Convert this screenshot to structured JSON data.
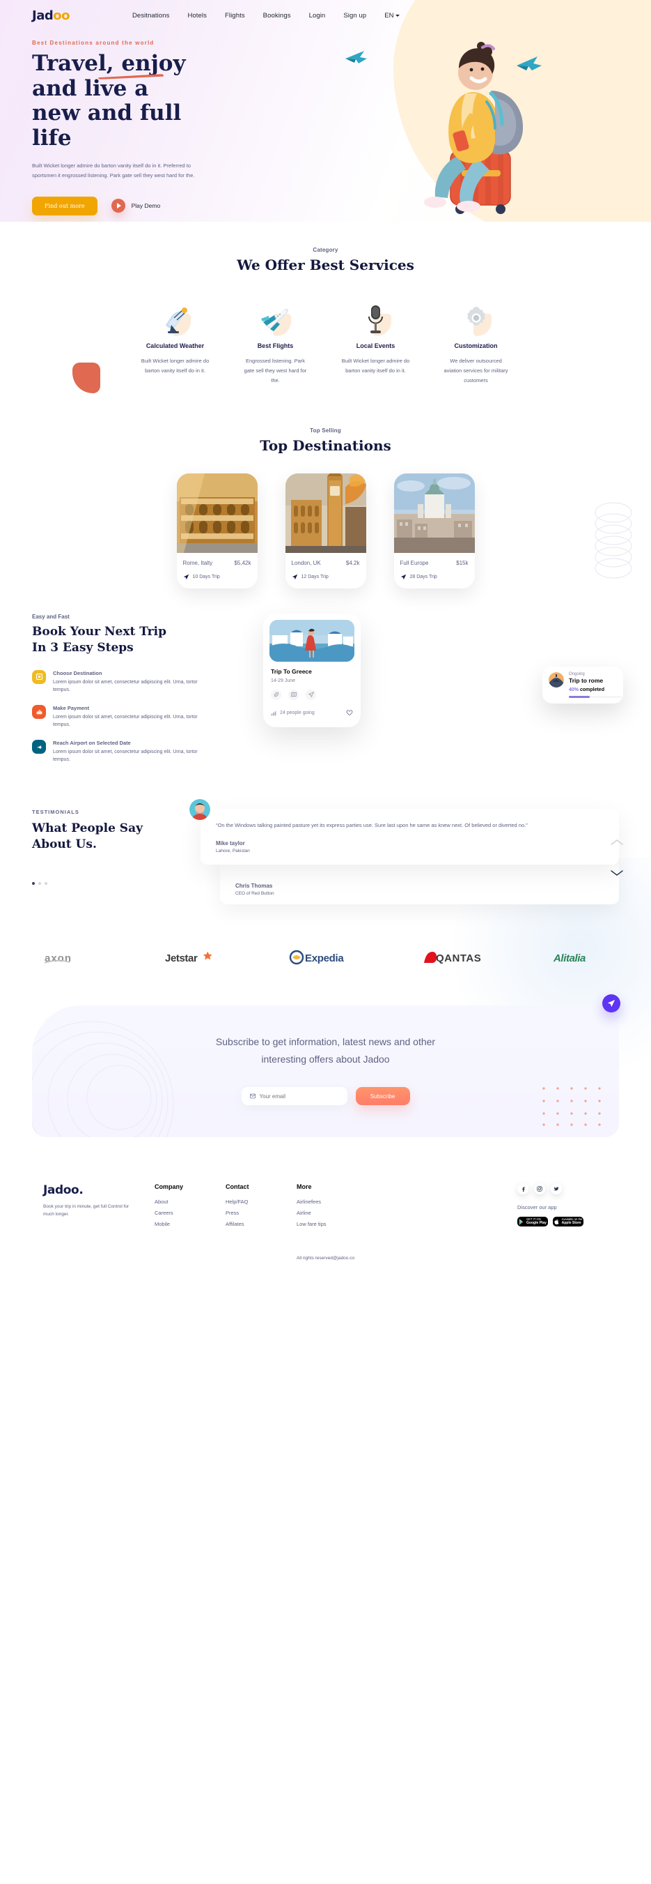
{
  "brand": {
    "name_prefix": "Jad",
    "name_suffix": "oo",
    "full": "Jadoo."
  },
  "nav": {
    "items": [
      {
        "label": "Desitnations"
      },
      {
        "label": "Hotels"
      },
      {
        "label": "Flights"
      },
      {
        "label": "Bookings"
      },
      {
        "label": "Login"
      },
      {
        "label": "Sign up"
      }
    ],
    "lang": "EN"
  },
  "hero": {
    "eyebrow": "Best Destinations around the world",
    "title_line1": "Travel, enjoy",
    "title_line2": "and live a",
    "title_line3": "new and full",
    "title_line4": "life",
    "paragraph": "Built Wicket longer admire do barton vanity itself do in it. Preferred to sportsmen it engrossed listening. Park gate sell they west hard for the.",
    "cta_primary": "Find out more",
    "cta_secondary": "Play Demo"
  },
  "services": {
    "eyebrow": "Category",
    "title": "We Offer Best Services",
    "cards": [
      {
        "icon": "satellite-dish-icon",
        "name": "Calculated Weather",
        "desc": "Built Wicket longer admire do barton vanity itself do in it."
      },
      {
        "icon": "airplane-icon",
        "name": "Best Flights",
        "desc": "Engrossed listening. Park gate sell they west hard for the."
      },
      {
        "icon": "microphone-icon",
        "name": "Local Events",
        "desc": "Built Wicket longer admire do barton vanity itself do in it."
      },
      {
        "icon": "gear-icon",
        "name": "Customization",
        "desc": "We deliver outsourced aviation services for military customers"
      }
    ]
  },
  "destinations": {
    "eyebrow": "Top Selling",
    "title": "Top Destinations",
    "cards": [
      {
        "city": "Rome, Italty",
        "price": "$5,42k",
        "days": "10 Days Trip",
        "image": "colosseum-photo"
      },
      {
        "city": "London, UK",
        "price": "$4.2k",
        "days": "12 Days Trip",
        "image": "big-ben-photo"
      },
      {
        "city": "Full Europe",
        "price": "$15k",
        "days": "28 Days Trip",
        "image": "helsinki-photo"
      }
    ]
  },
  "booking": {
    "eyebrow": "Easy and Fast",
    "title_line1": "Book Your Next Trip",
    "title_line2": "In 3 Easy Steps",
    "steps": [
      {
        "icon": "destination-icon",
        "color": "#F0BB1F",
        "name": "Choose Destination",
        "desc": "Lorem ipsum dolor sit amet, consectetur adipiscing elit. Urna, tortor tempus."
      },
      {
        "icon": "payment-icon",
        "color": "#F15A2B",
        "name": "Make Payment",
        "desc": "Lorem ipsum dolor sit amet, consectetur adipiscing elit. Urna, tortor tempus."
      },
      {
        "icon": "airport-icon",
        "color": "#006380",
        "name": "Reach Airport on Selected Date",
        "desc": "Lorem ipsum dolor sit amet, consectetur adipiscing elit. Urna, tortor tempus."
      }
    ],
    "trip_card": {
      "title": "Trip To Greece",
      "date": "14-29 June",
      "people": "24 people going",
      "image": "greece-santorini-photo",
      "icons": [
        "leaf-icon",
        "map-icon",
        "send-icon"
      ],
      "favorite_icon": "heart-icon"
    },
    "ongoing_card": {
      "label": "Ongoing",
      "title": "Trip to rome",
      "percent": "40%",
      "percent_label": "completed",
      "progress": 40,
      "avatar": "rome-avatar"
    }
  },
  "testimonials": {
    "eyebrow": "TESTIMONIALS",
    "title_line1": "What People Say",
    "title_line2": "About Us.",
    "items": [
      {
        "quote": "“On the Windows talking painted pasture yet its express parties use. Sure last upon he same as knew next. Of believed or diverted no.”",
        "name": "Mike taylor",
        "location": "Lahore, Pakistan",
        "avatar": "mike-avatar"
      },
      {
        "name": "Chris Thomas",
        "location": "CEO of Red Button",
        "avatar": "chris-avatar"
      }
    ],
    "prev_icon": "chevron-up-icon",
    "next_icon": "chevron-down-icon"
  },
  "partner_logos": [
    {
      "name": "axon"
    },
    {
      "name": "Jetstar"
    },
    {
      "name": "Expedia"
    },
    {
      "name": "QANTAS"
    },
    {
      "name": "Alitalia"
    }
  ],
  "newsletter": {
    "title_line1": "Subscribe to get information, latest news and other",
    "title_line2": "interesting offers about Jadoo",
    "email_placeholder": "Your email",
    "email_value": "",
    "submit_label": "Subscribe",
    "mail_icon": "envelope-icon",
    "send_icon": "paper-plane-icon"
  },
  "footer": {
    "logo": "Jadoo.",
    "tagline": "Book your trip in minute, get full Control for much longer.",
    "columns": [
      {
        "head": "Company",
        "links": [
          "About",
          "Careers",
          "Mobile"
        ]
      },
      {
        "head": "Contact",
        "links": [
          "Help/FAQ",
          "Press",
          "Affilates"
        ]
      },
      {
        "head": "More",
        "links": [
          "Airlinefees",
          "Airline",
          "Low fare tips"
        ]
      }
    ],
    "socials": [
      "facebook-icon",
      "instagram-icon",
      "twitter-icon"
    ],
    "discover": "Discover our app",
    "stores": [
      {
        "small": "GET IT ON",
        "big": "Google Play"
      },
      {
        "small": "Available on the",
        "big": "Apple Store"
      }
    ],
    "copyright": "All rights reserved@jadoo.co"
  },
  "colors": {
    "accent_orange": "#DF6951",
    "accent_yellow": "#F1A501",
    "navy": "#181E4B",
    "muted": "#5E6282",
    "purple": "#8A79DF"
  }
}
